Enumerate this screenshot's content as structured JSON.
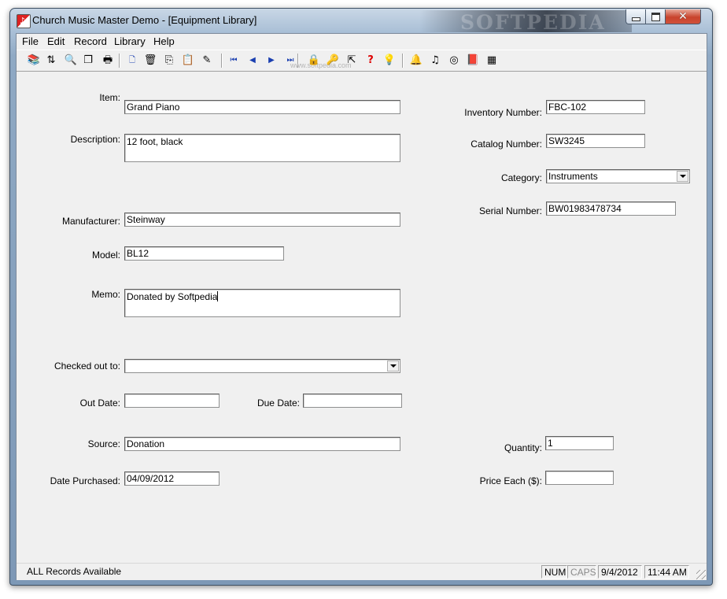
{
  "window": {
    "title": "Church Music Master Demo - [Equipment Library]",
    "watermark": "SOFTPEDIA",
    "controls": {
      "minimize": "minimize-icon",
      "maximize": "maximize-icon",
      "close": "close-icon"
    }
  },
  "menu": {
    "items": [
      "File",
      "Edit",
      "Record",
      "Library",
      "Help"
    ]
  },
  "toolbar": {
    "buttons": [
      {
        "icon": "find-books-icon",
        "glyph": "📚"
      },
      {
        "icon": "sort-az-icon",
        "glyph": "⇅"
      },
      {
        "icon": "zoom-icon",
        "glyph": "🔍"
      },
      {
        "icon": "copy-pages-icon",
        "glyph": "❐"
      },
      {
        "icon": "print-icon",
        "glyph": "🖶"
      },
      {
        "icon": "new-record-icon",
        "glyph": "🗋"
      },
      {
        "icon": "delete-icon",
        "glyph": "🗑"
      },
      {
        "icon": "copy-icon",
        "glyph": "⎘"
      },
      {
        "icon": "paste-icon",
        "glyph": "📋"
      },
      {
        "icon": "clear-icon",
        "glyph": "✎"
      },
      {
        "icon": "first-record-icon",
        "glyph": "⏮"
      },
      {
        "icon": "previous-record-icon",
        "glyph": "◀"
      },
      {
        "icon": "next-record-icon",
        "glyph": "▶"
      },
      {
        "icon": "last-record-icon",
        "glyph": "⏭"
      },
      {
        "icon": "lock-icon",
        "glyph": "🔒"
      },
      {
        "icon": "key-icon",
        "glyph": "🔑"
      },
      {
        "icon": "pointer-icon",
        "glyph": "⇱"
      },
      {
        "icon": "help-icon",
        "glyph": "?"
      },
      {
        "icon": "tip-icon",
        "glyph": "💡"
      },
      {
        "icon": "bell-icon",
        "glyph": "🔔"
      },
      {
        "icon": "music-note-icon",
        "glyph": "♫"
      },
      {
        "icon": "cd-icon",
        "glyph": "◎"
      },
      {
        "icon": "book-icon",
        "glyph": "📕"
      },
      {
        "icon": "calculator-icon",
        "glyph": "▦"
      }
    ],
    "toolbar_watermark": "www.softpedia.com"
  },
  "form": {
    "item": {
      "label": "Item:",
      "value": "Grand Piano"
    },
    "description": {
      "label": "Description:",
      "value": "12 foot, black"
    },
    "manufacturer": {
      "label": "Manufacturer:",
      "value": "Steinway"
    },
    "model": {
      "label": "Model:",
      "value": "BL12"
    },
    "memo": {
      "label": "Memo:",
      "value": "Donated by Softpedia"
    },
    "checked_out_to": {
      "label": "Checked out to:",
      "value": ""
    },
    "out_date": {
      "label": "Out Date:",
      "value": ""
    },
    "due_date": {
      "label": "Due Date:",
      "value": ""
    },
    "source": {
      "label": "Source:",
      "value": "Donation"
    },
    "date_purchased": {
      "label": "Date Purchased:",
      "value": "04/09/2012"
    },
    "inventory_number": {
      "label": "Inventory Number:",
      "value": "FBC-102"
    },
    "catalog_number": {
      "label": "Catalog Number:",
      "value": "SW3245"
    },
    "category": {
      "label": "Category:",
      "value": "Instruments"
    },
    "serial_number": {
      "label": "Serial Number:",
      "value": "BW01983478734"
    },
    "quantity": {
      "label": "Quantity:",
      "value": "1"
    },
    "price_each": {
      "label": "Price Each ($):",
      "value": ""
    }
  },
  "status": {
    "message": "ALL Records Available",
    "num": "NUM",
    "caps": "CAPS",
    "date": "9/4/2012",
    "time": "11:44 AM"
  }
}
